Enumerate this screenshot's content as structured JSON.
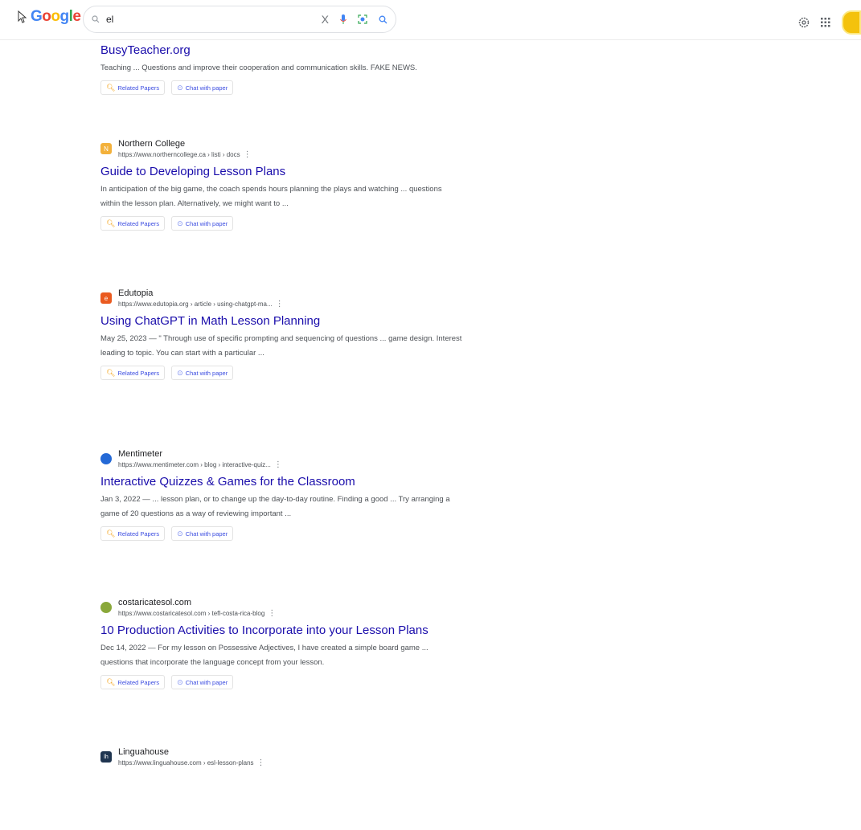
{
  "header": {
    "logo_letters": [
      "G",
      "o",
      "o",
      "g",
      "l",
      "e"
    ],
    "search_query": "el",
    "clear_glyph": "X"
  },
  "results": [
    {
      "title": "BusyTeacher.org",
      "snippet": "Teaching ... Questions and improve their cooperation and communication skills. FAKE NEWS.",
      "chips": [
        "Related Papers",
        "Chat with paper"
      ]
    },
    {
      "site_name": "Northern College",
      "url": "https://www.northerncollege.ca › listi › docs",
      "favicon_letter": "N",
      "favicon_color": "#f3b13b",
      "title": "Guide to Developing Lesson Plans",
      "snippet": "In anticipation of the big game, the coach spends hours planning the plays and watching ... questions within the lesson plan. Alternatively, we might want to ...",
      "chips": [
        "Related Papers",
        "Chat with paper"
      ]
    },
    {
      "site_name": "Edutopia",
      "url": "https://www.edutopia.org › article › using-chatgpt-ma...",
      "favicon_letter": "e",
      "favicon_color": "#ea5a1f",
      "title": "Using ChatGPT in Math Lesson Planning",
      "snippet": "May 25, 2023 — \" Through use of specific prompting and sequencing of questions ... game design. Interest leading to topic. You can start with a particular ...",
      "chips": [
        "Related Papers",
        "Chat with paper"
      ]
    },
    {
      "site_name": "Mentimeter",
      "url": "https://www.mentimeter.com › blog › interactive-quiz...",
      "favicon_letter": "",
      "favicon_color": "#2469d6",
      "title": "Interactive Quizzes & Games for the Classroom",
      "snippet": "Jan 3, 2022 — ... lesson plan, or to change up the day-to-day routine. Finding a good ... Try arranging a game of 20 questions as a way of reviewing important ...",
      "chips": [
        "Related Papers",
        "Chat with paper"
      ]
    },
    {
      "site_name": "costaricatesol.com",
      "url": "https://www.costaricatesol.com › tefl-costa-rica-blog",
      "favicon_letter": "",
      "favicon_color": "#8aa83a",
      "title": "10 Production Activities to Incorporate into your Lesson Plans",
      "snippet": "Dec 14, 2022 — For my lesson on Possessive Adjectives, I have created a simple board game ... questions that incorporate the language concept from your lesson.",
      "chips": [
        "Related Papers",
        "Chat with paper"
      ]
    },
    {
      "site_name": "Linguahouse",
      "url": "https://www.linguahouse.com › esl-lesson-plans",
      "favicon_letter": "lh",
      "favicon_color": "#1f3550"
    }
  ]
}
